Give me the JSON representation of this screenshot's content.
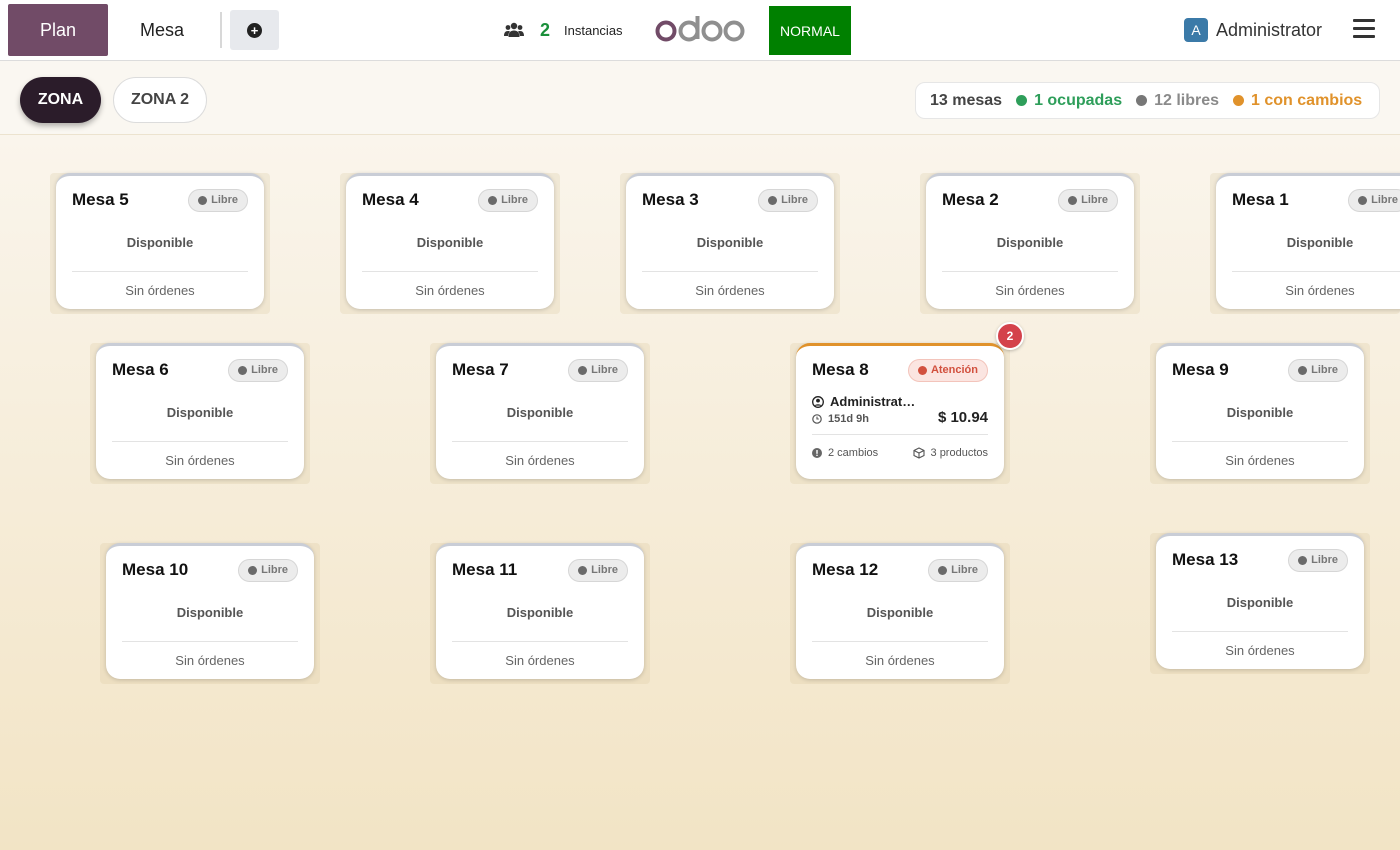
{
  "navbar": {
    "plan_label": "Plan",
    "mesa_label": "Mesa",
    "add_icon": "plus-circle-icon",
    "instances": {
      "count": "2",
      "label": "Instancias"
    },
    "logo_text": "odoo",
    "mode": "NORMAL",
    "user": {
      "initial": "A",
      "name": "Administrator"
    },
    "colors": {
      "primary": "#714b67",
      "mode_bg": "#008000"
    }
  },
  "toolbar": {
    "zones": [
      "ZONA",
      "ZONA 2"
    ],
    "summary": {
      "total": "13 mesas",
      "occupied": "1 ocupadas",
      "free": "12 libres",
      "changes": "1 con cambios"
    },
    "colors": {
      "occupied": "#2e9e5a",
      "free": "#8a8a8a",
      "changes": "#e0922b"
    }
  },
  "tables": [
    {
      "name": "Mesa 5",
      "status": "Libre",
      "availability": "Disponible",
      "orders": "Sin órdenes"
    },
    {
      "name": "Mesa 4",
      "status": "Libre",
      "availability": "Disponible",
      "orders": "Sin órdenes"
    },
    {
      "name": "Mesa 3",
      "status": "Libre",
      "availability": "Disponible",
      "orders": "Sin órdenes"
    },
    {
      "name": "Mesa 2",
      "status": "Libre",
      "availability": "Disponible",
      "orders": "Sin órdenes"
    },
    {
      "name": "Mesa 1",
      "status": "Libre",
      "availability": "Disponible",
      "orders": "Sin órdenes"
    },
    {
      "name": "Mesa 6",
      "status": "Libre",
      "availability": "Disponible",
      "orders": "Sin órdenes"
    },
    {
      "name": "Mesa 7",
      "status": "Libre",
      "availability": "Disponible",
      "orders": "Sin órdenes"
    },
    {
      "name": "Mesa 8",
      "status": "Atención",
      "customer": "Administrat…",
      "time": "151d 9h",
      "amount": "$ 10.94",
      "changes": "2 cambios",
      "products": "3 productos",
      "badge": "2"
    },
    {
      "name": "Mesa 9",
      "status": "Libre",
      "availability": "Disponible",
      "orders": "Sin órdenes"
    },
    {
      "name": "Mesa 10",
      "status": "Libre",
      "availability": "Disponible",
      "orders": "Sin órdenes"
    },
    {
      "name": "Mesa 11",
      "status": "Libre",
      "availability": "Disponible",
      "orders": "Sin órdenes"
    },
    {
      "name": "Mesa 12",
      "status": "Libre",
      "availability": "Disponible",
      "orders": "Sin órdenes"
    },
    {
      "name": "Mesa 13",
      "status": "Libre",
      "availability": "Disponible",
      "orders": "Sin órdenes"
    }
  ]
}
